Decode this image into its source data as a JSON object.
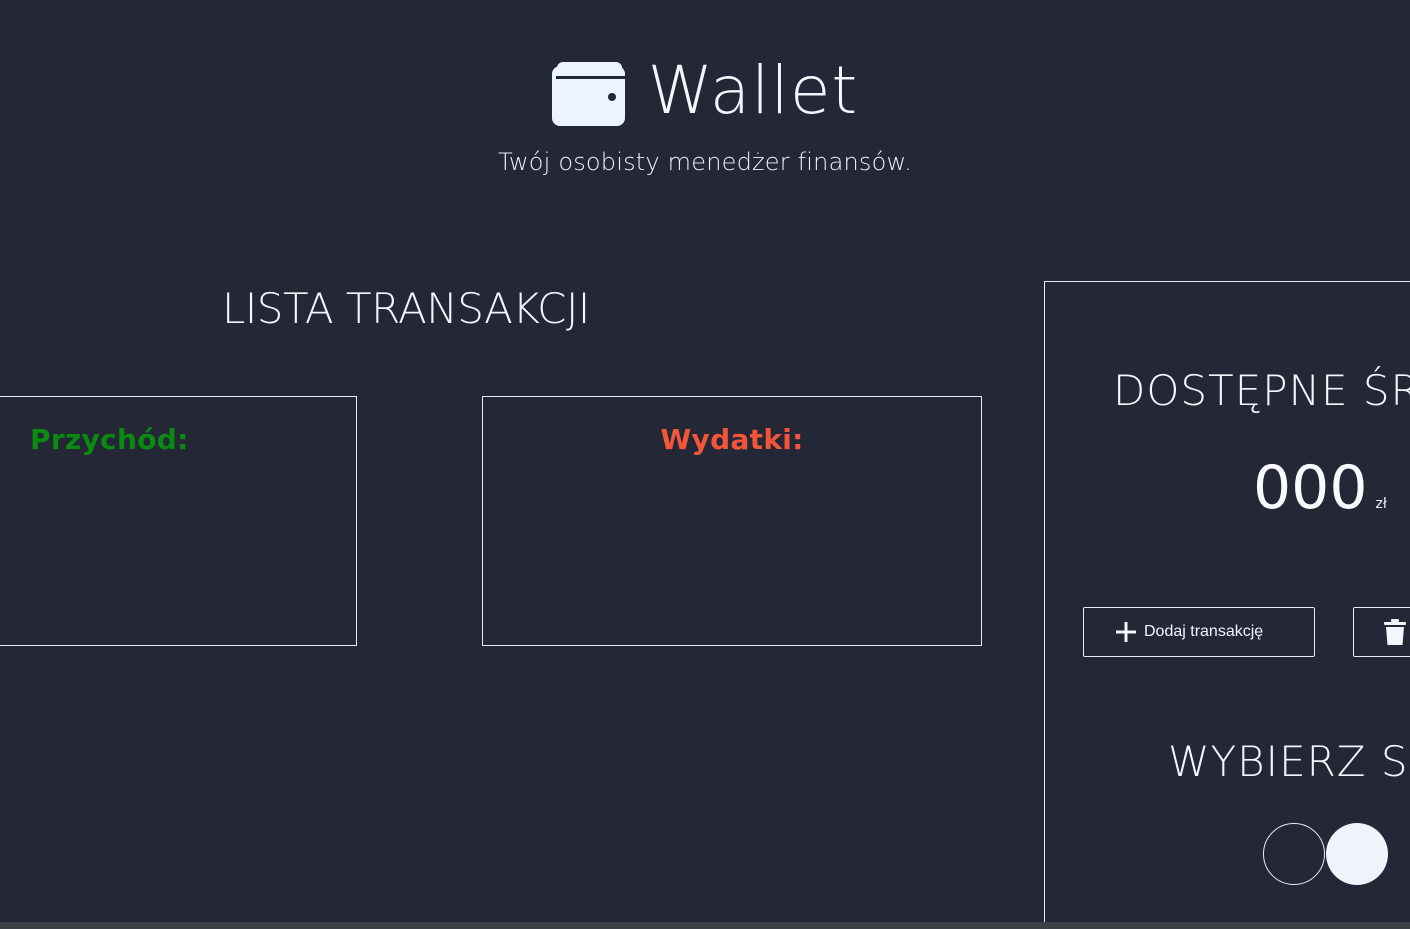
{
  "header": {
    "icon": "wallet-icon",
    "title": "Wallet",
    "tagline": "Twój osobisty menedżer finansów."
  },
  "transactions": {
    "title": "LISTA TRANSAKCJI",
    "income_heading": "Przychód:",
    "expenses_heading": "Wydatki:"
  },
  "panel": {
    "funds_title": "DOSTĘPNE ŚR",
    "amount": "000",
    "currency": "zł",
    "add_button_label": "Dodaj transakcję",
    "add_button_icon": "plus-icon",
    "delete_button_icon": "trash-icon",
    "theme_title": "WYBIERZ S",
    "theme_options": [
      "dark",
      "light"
    ]
  },
  "colors": {
    "background": "#232736",
    "text": "#f3f6fc",
    "income": "#0b8a10",
    "expenses": "#f25537"
  }
}
